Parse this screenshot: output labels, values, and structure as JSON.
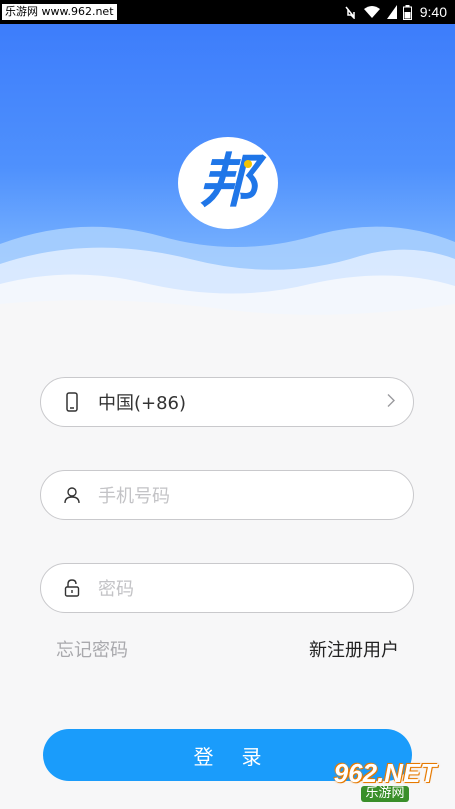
{
  "status_bar": {
    "watermark": "乐游网 www.962.net",
    "time": "9:40"
  },
  "logo": {
    "glyph": "邦"
  },
  "form": {
    "country": {
      "value": "中国(+86)"
    },
    "phone": {
      "placeholder": "手机号码"
    },
    "password": {
      "placeholder": "密码"
    },
    "forgot_label": "忘记密码",
    "register_label": "新注册用户",
    "login_label": "登录"
  },
  "watermark_bottom": {
    "number": "962.NET",
    "caption": "乐游网"
  },
  "colors": {
    "primary": "#1a9cfb",
    "hero_top": "#3d7dfb"
  }
}
